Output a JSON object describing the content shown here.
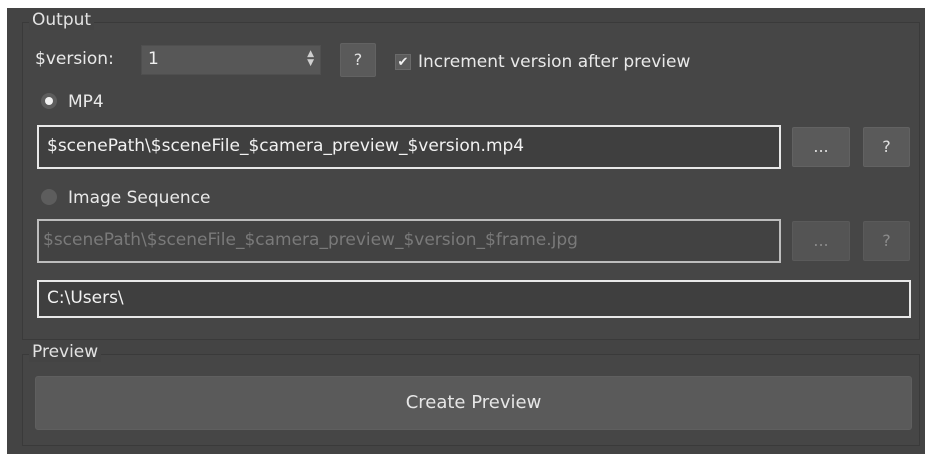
{
  "output": {
    "title": "Output",
    "version_label": "$version:",
    "version_value": "1",
    "version_help": "?",
    "increment_checked": true,
    "increment_label": "Increment version after preview",
    "mp4": {
      "label": "MP4",
      "selected": true,
      "path": "$scenePath\\$sceneFile_$camera_preview_$version.mp4",
      "browse_label": "...",
      "help_label": "?"
    },
    "image_sequence": {
      "label": "Image Sequence",
      "selected": false,
      "path": "$scenePath\\$sceneFile_$camera_preview_$version_$frame.jpg",
      "browse_label": "...",
      "help_label": "?"
    },
    "resolved_path": "C:\\Users\\"
  },
  "preview": {
    "title": "Preview",
    "create_label": "Create Preview"
  }
}
